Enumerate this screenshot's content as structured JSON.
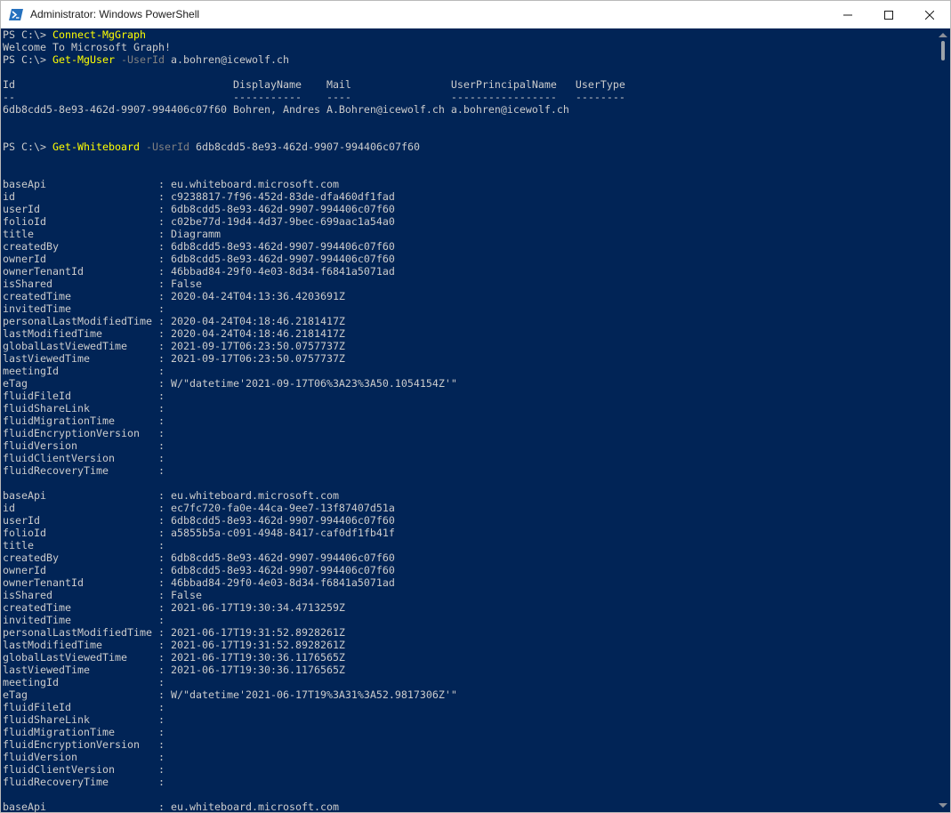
{
  "window": {
    "title": "Administrator: Windows PowerShell",
    "icon": "powershell-icon",
    "controls": [
      "minimize-icon",
      "maximize-icon",
      "close-icon"
    ],
    "colors": {
      "console_background": "#012456",
      "text": "#cccccc",
      "command": "#ffff00",
      "parameter": "#808080"
    }
  },
  "console": {
    "prompt": "PS C:\\> ",
    "sessions": [
      {
        "command": "Connect-MgGraph",
        "output": "Welcome To Microsoft Graph!"
      },
      {
        "command": "Get-MgUser",
        "param": "-UserId",
        "arg": "a.bohren@icewolf.ch",
        "table": {
          "header": "Id                                   DisplayName    Mail                UserPrincipalName   UserType",
          "separator": "--                                   -----------    ----                -----------------   --------",
          "row": "6db8cdd5-8e93-462d-9907-994406c07f60 Bohren, Andres A.Bohren@icewolf.ch a.bohren@icewolf.ch"
        }
      },
      {
        "command": "Get-Whiteboard",
        "param": "-UserId",
        "arg": "6db8cdd5-8e93-462d-9907-994406c07f60"
      }
    ],
    "whiteboards": [
      [
        "baseApi                  : eu.whiteboard.microsoft.com",
        "id                       : c9238817-7f96-452d-83de-dfa460df1fad",
        "userId                   : 6db8cdd5-8e93-462d-9907-994406c07f60",
        "folioId                  : c02be77d-19d4-4d37-9bec-699aac1a54a0",
        "title                    : Diagramm",
        "createdBy                : 6db8cdd5-8e93-462d-9907-994406c07f60",
        "ownerId                  : 6db8cdd5-8e93-462d-9907-994406c07f60",
        "ownerTenantId            : 46bbad84-29f0-4e03-8d34-f6841a5071ad",
        "isShared                 : False",
        "createdTime              : 2020-04-24T04:13:36.4203691Z",
        "invitedTime              :",
        "personalLastModifiedTime : 2020-04-24T04:18:46.2181417Z",
        "lastModifiedTime         : 2020-04-24T04:18:46.2181417Z",
        "globalLastViewedTime     : 2021-09-17T06:23:50.0757737Z",
        "lastViewedTime           : 2021-09-17T06:23:50.0757737Z",
        "meetingId                :",
        "eTag                     : W/\"datetime'2021-09-17T06%3A23%3A50.1054154Z'\"",
        "fluidFileId              :",
        "fluidShareLink           :",
        "fluidMigrationTime       :",
        "fluidEncryptionVersion   :",
        "fluidVersion             :",
        "fluidClientVersion       :",
        "fluidRecoveryTime        :"
      ],
      [
        "baseApi                  : eu.whiteboard.microsoft.com",
        "id                       : ec7fc720-fa0e-44ca-9ee7-13f87407d51a",
        "userId                   : 6db8cdd5-8e93-462d-9907-994406c07f60",
        "folioId                  : a5855b5a-c091-4948-8417-caf0df1fb41f",
        "title                    :",
        "createdBy                : 6db8cdd5-8e93-462d-9907-994406c07f60",
        "ownerId                  : 6db8cdd5-8e93-462d-9907-994406c07f60",
        "ownerTenantId            : 46bbad84-29f0-4e03-8d34-f6841a5071ad",
        "isShared                 : False",
        "createdTime              : 2021-06-17T19:30:34.4713259Z",
        "invitedTime              :",
        "personalLastModifiedTime : 2021-06-17T19:31:52.8928261Z",
        "lastModifiedTime         : 2021-06-17T19:31:52.8928261Z",
        "globalLastViewedTime     : 2021-06-17T19:30:36.1176565Z",
        "lastViewedTime           : 2021-06-17T19:30:36.1176565Z",
        "meetingId                :",
        "eTag                     : W/\"datetime'2021-06-17T19%3A31%3A52.9817306Z'\"",
        "fluidFileId              :",
        "fluidShareLink           :",
        "fluidMigrationTime       :",
        "fluidEncryptionVersion   :",
        "fluidVersion             :",
        "fluidClientVersion       :",
        "fluidRecoveryTime        :"
      ],
      [
        "baseApi                  : eu.whiteboard.microsoft.com"
      ]
    ]
  }
}
